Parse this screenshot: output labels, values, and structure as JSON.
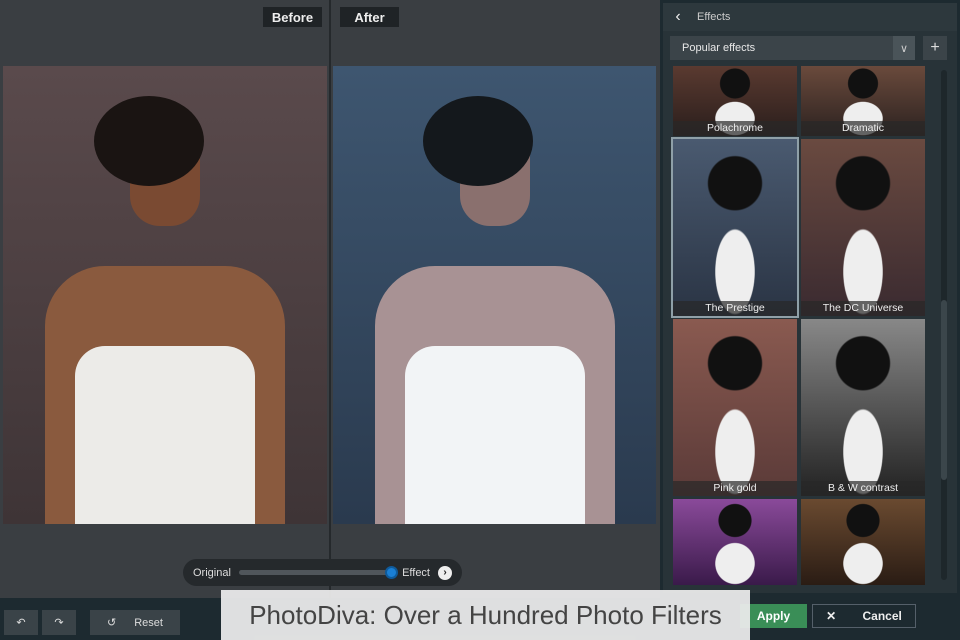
{
  "compare": {
    "before_label": "Before",
    "after_label": "After"
  },
  "slider": {
    "left_label": "Original",
    "right_label": "Effect",
    "value_percent": 100
  },
  "panel": {
    "title": "Effects",
    "category": "Popular effects",
    "effects": [
      {
        "name": "Polachrome",
        "c1": "#5a3a30",
        "c2": "#2a1e1c"
      },
      {
        "name": "Dramatic",
        "c1": "#6a4a3c",
        "c2": "#2c2220"
      },
      {
        "name": "The Prestige",
        "c1": "#4a5a70",
        "c2": "#2a3444"
      },
      {
        "name": "The DC Universe",
        "c1": "#6a4a40",
        "c2": "#3a2a30"
      },
      {
        "name": "Pink gold",
        "c1": "#8a5a50",
        "c2": "#5a3a38"
      },
      {
        "name": "B & W contrast",
        "c1": "#888",
        "c2": "#222"
      },
      {
        "name": "",
        "c1": "#8a4a9a",
        "c2": "#3a1a4a"
      },
      {
        "name": "",
        "c1": "#6a4a30",
        "c2": "#2a1c14"
      }
    ]
  },
  "toolbar": {
    "reset_label": "Reset",
    "apply_label": "Apply",
    "cancel_label": "Cancel"
  },
  "caption": "PhotoDiva: Over a Hundred Photo Filters"
}
